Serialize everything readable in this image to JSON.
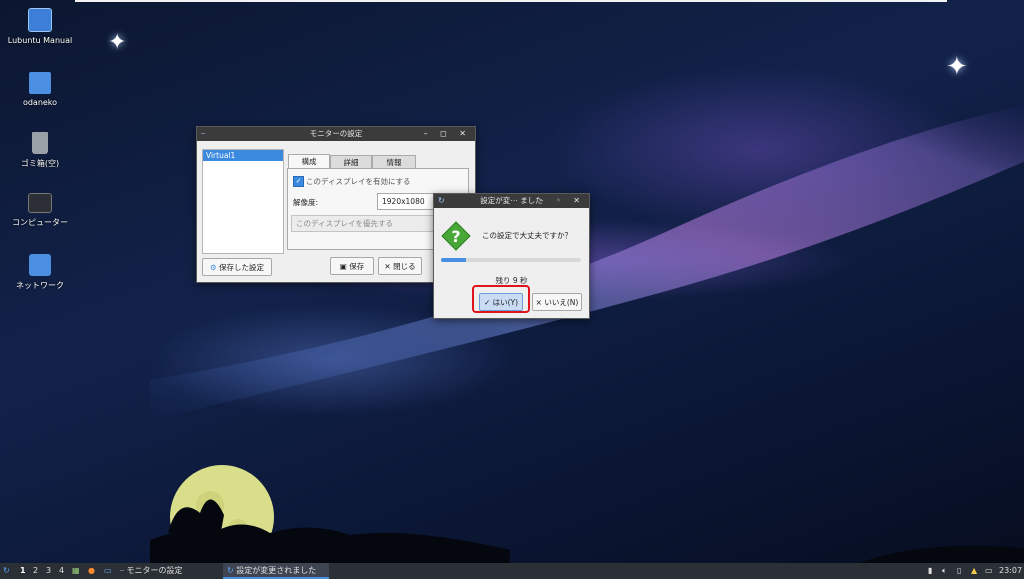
{
  "desktop_icons": [
    {
      "label": "Lubuntu Manual",
      "icon": "manual-icon"
    },
    {
      "label": "odaneko",
      "icon": "home-folder-icon"
    },
    {
      "label": "ゴミ箱(空)",
      "icon": "trash-icon"
    },
    {
      "label": "コンピューター",
      "icon": "computer-icon"
    },
    {
      "label": "ネットワーク",
      "icon": "network-icon"
    }
  ],
  "monitor_window": {
    "title": "モニターの設定",
    "monitor_list": [
      "Virtual1"
    ],
    "tabs": [
      "構成",
      "詳細",
      "情報"
    ],
    "enable_checkbox_label": "このディスプレイを有効にする",
    "resolution_label": "解像度:",
    "resolution_value": "1920x1080",
    "primary_label": "このディスプレイを優先する",
    "saved_settings_button": "保存した設定",
    "save_button": "保存",
    "close_button": "閉じる"
  },
  "confirm_dialog": {
    "title": "設定が変⋯ ました",
    "message": "この設定で大丈夫ですか？",
    "progress_fraction": 0.18,
    "remaining_text": "残り 9 秒",
    "yes_button": "はい(Y)",
    "no_button": "いいえ(N)",
    "highlight_color": "#e0141c"
  },
  "taskbar": {
    "workspaces": [
      "1",
      "2",
      "3",
      "4"
    ],
    "tasks": [
      "モニターの設定",
      "設定が変更されました"
    ],
    "clock": "23:07"
  }
}
